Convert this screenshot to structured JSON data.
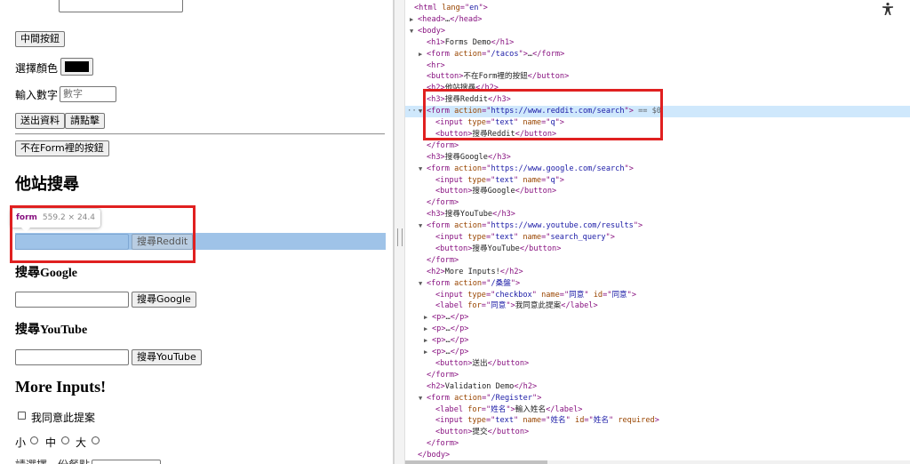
{
  "page": {
    "middle_button": "中間按鈕",
    "color_label": "選擇顏色",
    "color_value": "#000000",
    "number_label": "輸入數字",
    "number_placeholder": "數字",
    "submit_button": "送出資料",
    "click_button": "請點擊",
    "outside_form_button": "不在Form裡的按鈕",
    "other_search_heading": "他站搜尋",
    "tooltip_tag": "form",
    "tooltip_dims": "559.2 × 24.4",
    "reddit_button": "搜尋Reddit",
    "google_heading": "搜尋Google",
    "google_button": "搜尋Google",
    "youtube_heading": "搜尋YouTube",
    "youtube_button": "搜尋YouTube",
    "more_inputs_heading": "More Inputs!",
    "agree_label": "我同意此提案",
    "size_small": "小",
    "size_medium": "中",
    "size_large": "大",
    "bottom_partial": "請選擇一份餐點"
  },
  "devtools": {
    "selected_suffix": "== $0",
    "lines": [
      {
        "tri": "",
        "html": "<span class='tg'>&lt;html</span> <span class='an'>lang</span><span class='tg'>=\"</span><span class='av'>en</span><span class='tg'>\"&gt;</span>"
      },
      {
        "tri": "▶",
        "html": "<span class='tg'>&lt;head&gt;</span><span class='tx'>…</span><span class='tg'>&lt;/head&gt;</span>"
      },
      {
        "tri": "▼",
        "html": "<span class='tg'>&lt;body&gt;</span>"
      },
      {
        "tri": "",
        "html": "<span class='tg'>&lt;h1&gt;</span><span class='tx'>Forms Demo</span><span class='tg'>&lt;/h1&gt;</span>"
      },
      {
        "tri": "▶",
        "html": "<span class='tg'>&lt;form</span> <span class='an'>action</span><span class='tg'>=\"</span><span class='av'>/tacos</span><span class='tg'>\"&gt;</span><span class='tx'>…</span><span class='tg'>&lt;/form&gt;</span>"
      },
      {
        "tri": "",
        "html": "<span class='tg'>&lt;hr&gt;</span>"
      },
      {
        "tri": "",
        "html": "<span class='tg'>&lt;button&gt;</span><span class='tx'>不在Form裡的按鈕</span><span class='tg'>&lt;/button&gt;</span>"
      },
      {
        "tri": "",
        "html": "<span class='tg'>&lt;h2&gt;</span><span class='tx'>他站搜尋</span><span class='tg'>&lt;/h2&gt;</span>"
      },
      {
        "tri": "",
        "html": "<span class='tg'>&lt;h3&gt;</span><span class='tx'>搜尋Reddit</span><span class='tg'>&lt;/h3&gt;</span>"
      },
      {
        "tri": "▼",
        "html": "<span class='tg'>&lt;form</span> <span class='an'>action</span><span class='tg'>=\"</span><span class='av'>https://www.reddit.com/search</span><span class='tg'>\"&gt;</span> <span class='dollar'>== $0</span>"
      },
      {
        "tri": "",
        "html": "<span class='tg'>&lt;input</span> <span class='an'>type</span><span class='tg'>=\"</span><span class='av'>text</span><span class='tg'>\"</span> <span class='an'>name</span><span class='tg'>=\"</span><span class='av'>q</span><span class='tg'>\"&gt;</span>"
      },
      {
        "tri": "",
        "html": "<span class='tg'>&lt;button&gt;</span><span class='tx'>搜尋Reddit</span><span class='tg'>&lt;/button&gt;</span>"
      },
      {
        "tri": "",
        "html": "<span class='tg'>&lt;/form&gt;</span>"
      },
      {
        "tri": "",
        "html": "<span class='tg'>&lt;h3&gt;</span><span class='tx'>搜尋Google</span><span class='tg'>&lt;/h3&gt;</span>"
      },
      {
        "tri": "▼",
        "html": "<span class='tg'>&lt;form</span> <span class='an'>action</span><span class='tg'>=\"</span><span class='av'>https://www.google.com/search</span><span class='tg'>\"&gt;</span>"
      },
      {
        "tri": "",
        "html": "<span class='tg'>&lt;input</span> <span class='an'>type</span><span class='tg'>=\"</span><span class='av'>text</span><span class='tg'>\"</span> <span class='an'>name</span><span class='tg'>=\"</span><span class='av'>q</span><span class='tg'>\"&gt;</span>"
      },
      {
        "tri": "",
        "html": "<span class='tg'>&lt;button&gt;</span><span class='tx'>搜尋Google</span><span class='tg'>&lt;/button&gt;</span>"
      },
      {
        "tri": "",
        "html": "<span class='tg'>&lt;/form&gt;</span>"
      },
      {
        "tri": "",
        "html": "<span class='tg'>&lt;h3&gt;</span><span class='tx'>搜尋YouTube</span><span class='tg'>&lt;/h3&gt;</span>"
      },
      {
        "tri": "▼",
        "html": "<span class='tg'>&lt;form</span> <span class='an'>action</span><span class='tg'>=\"</span><span class='av'>https://www.youtube.com/results</span><span class='tg'>\"&gt;</span>"
      },
      {
        "tri": "",
        "html": "<span class='tg'>&lt;input</span> <span class='an'>type</span><span class='tg'>=\"</span><span class='av'>text</span><span class='tg'>\"</span> <span class='an'>name</span><span class='tg'>=\"</span><span class='av'>search_query</span><span class='tg'>\"&gt;</span>"
      },
      {
        "tri": "",
        "html": "<span class='tg'>&lt;button&gt;</span><span class='tx'>搜尋YouTube</span><span class='tg'>&lt;/button&gt;</span>"
      },
      {
        "tri": "",
        "html": "<span class='tg'>&lt;/form&gt;</span>"
      },
      {
        "tri": "",
        "html": "<span class='tg'>&lt;h2&gt;</span><span class='tx'>More Inputs!</span><span class='tg'>&lt;/h2&gt;</span>"
      },
      {
        "tri": "▼",
        "html": "<span class='tg'>&lt;form</span> <span class='an'>action</span><span class='tg'>=\"</span><span class='av'>/桑盤</span><span class='tg'>\"&gt;</span>"
      },
      {
        "tri": "",
        "html": "<span class='tg'>&lt;input</span> <span class='an'>type</span><span class='tg'>=\"</span><span class='av'>checkbox</span><span class='tg'>\"</span> <span class='an'>name</span><span class='tg'>=\"</span><span class='av'>同意</span><span class='tg'>\"</span> <span class='an'>id</span><span class='tg'>=\"</span><span class='av'>同意</span><span class='tg'>\"&gt;</span>"
      },
      {
        "tri": "",
        "html": "<span class='tg'>&lt;label</span> <span class='an'>for</span><span class='tg'>=\"</span><span class='av'>同意</span><span class='tg'>\"&gt;</span><span class='tx'>我同意此提案</span><span class='tg'>&lt;/label&gt;</span>"
      },
      {
        "tri": "▶",
        "html": "<span class='tg'>&lt;p&gt;</span><span class='tx'>…</span><span class='tg'>&lt;/p&gt;</span>"
      },
      {
        "tri": "▶",
        "html": "<span class='tg'>&lt;p&gt;</span><span class='tx'>…</span><span class='tg'>&lt;/p&gt;</span>"
      },
      {
        "tri": "▶",
        "html": "<span class='tg'>&lt;p&gt;</span><span class='tx'>…</span><span class='tg'>&lt;/p&gt;</span>"
      },
      {
        "tri": "▶",
        "html": "<span class='tg'>&lt;p&gt;</span><span class='tx'>…</span><span class='tg'>&lt;/p&gt;</span>"
      },
      {
        "tri": "",
        "html": "<span class='tg'>&lt;button&gt;</span><span class='tx'>送出</span><span class='tg'>&lt;/button&gt;</span>"
      },
      {
        "tri": "",
        "html": "<span class='tg'>&lt;/form&gt;</span>"
      },
      {
        "tri": "",
        "html": "<span class='tg'>&lt;h2&gt;</span><span class='tx'>Validation Demo</span><span class='tg'>&lt;/h2&gt;</span>"
      },
      {
        "tri": "▼",
        "html": "<span class='tg'>&lt;form</span> <span class='an'>action</span><span class='tg'>=\"</span><span class='av'>/Register</span><span class='tg'>\"&gt;</span>"
      },
      {
        "tri": "",
        "html": "<span class='tg'>&lt;label</span> <span class='an'>for</span><span class='tg'>=\"</span><span class='av'>姓名</span><span class='tg'>\"&gt;</span><span class='tx'>輸入姓名</span><span class='tg'>&lt;/label&gt;</span>"
      },
      {
        "tri": "",
        "html": "<span class='tg'>&lt;input</span> <span class='an'>type</span><span class='tg'>=\"</span><span class='av'>text</span><span class='tg'>\"</span> <span class='an'>name</span><span class='tg'>=\"</span><span class='av'>姓名</span><span class='tg'>\"</span> <span class='an'>id</span><span class='tg'>=\"</span><span class='av'>姓名</span><span class='tg'>\"</span> <span class='an'>required</span><span class='tg'>&gt;</span>"
      },
      {
        "tri": "",
        "html": "<span class='tg'>&lt;button&gt;</span><span class='tx'>提交</span><span class='tg'>&lt;/button&gt;</span>"
      },
      {
        "tri": "",
        "html": "<span class='tg'>&lt;/form&gt;</span>"
      },
      {
        "tri": "",
        "html": "<span class='tg'>&lt;/body&gt;</span>"
      }
    ]
  }
}
